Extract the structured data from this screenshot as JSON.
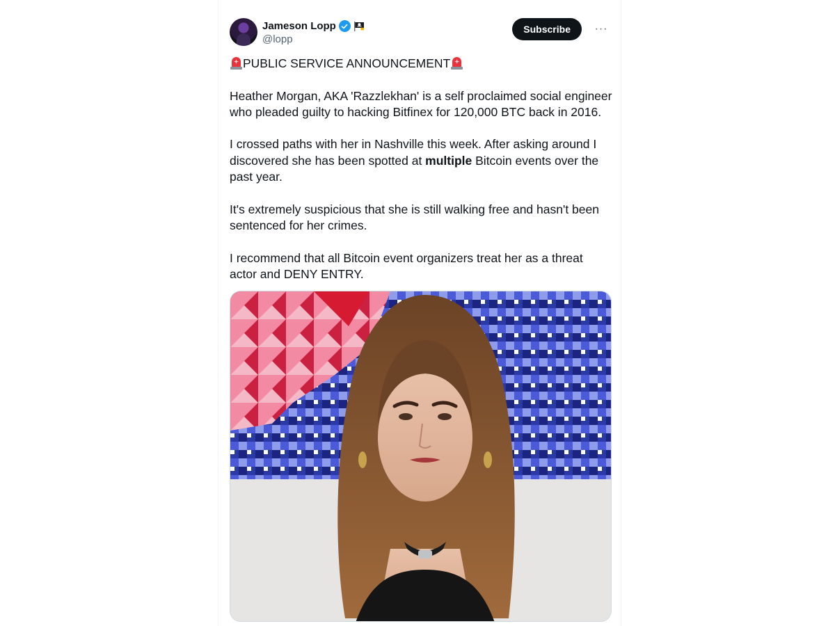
{
  "tweet": {
    "author": {
      "display_name": "Jameson Lopp",
      "handle": "@lopp",
      "verified": true
    },
    "subscribe_label": "Subscribe",
    "more_label": "···",
    "announcement": "PUBLIC SERVICE ANNOUNCEMENT",
    "paragraph_1": "Heather Morgan, AKA 'Razzlekhan' is a self proclaimed social engineer who pleaded guilty to hacking Bitfinex for 120,000 BTC back in 2016.",
    "paragraph_2_before": "I crossed paths with her in Nashville this week. After asking around I discovered she has been spotted at ",
    "paragraph_2_bold": "multiple",
    "paragraph_2_after": " Bitcoin events over the past year.",
    "paragraph_3": "It's extremely suspicious that she is still walking free and hasn't been sentenced for her crimes.",
    "paragraph_4": "I recommend that all Bitcoin event organizers treat her as a threat actor and DENY ENTRY."
  },
  "icons": {
    "verified": "verified-badge-icon",
    "flag": "pirate-flag-icon",
    "siren": "police-siren-icon",
    "more": "more-options-icon"
  },
  "colors": {
    "accent": "#1d9bf0",
    "button_bg": "#0f1419",
    "secondary_text": "#536471",
    "siren": "#e8323c"
  }
}
